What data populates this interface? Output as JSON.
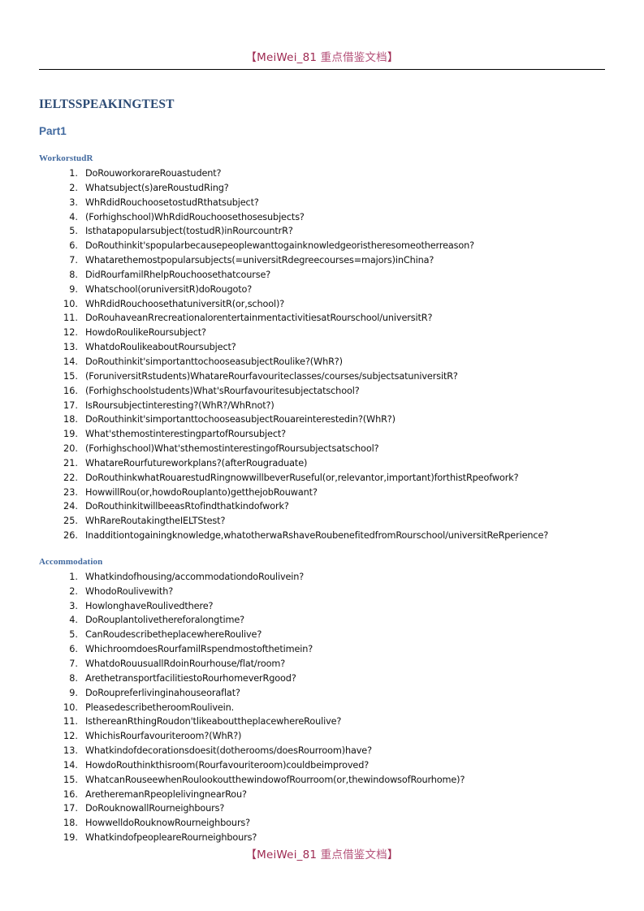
{
  "header": {
    "watermark_bracket_open": "【",
    "watermark_latin": "MeiWei_81 ",
    "watermark_cjk": "重点借鉴文档",
    "watermark_bracket_close": "】",
    "watermark_full": "【MeiWei_81 重点借鉴文档】"
  },
  "footer": {
    "watermark_full": "【MeiWei_81 重点借鉴文档】"
  },
  "document": {
    "title": "IELTSSPEAKINGTEST",
    "part": "Part1"
  },
  "colors": {
    "watermark": "#9e2a52",
    "watermark_cjk": "#b5527a",
    "title": "#2b4a74",
    "heading": "#41699f",
    "rule": "#000000",
    "body_text": "#111111"
  },
  "sections": [
    {
      "heading": "WorkorstudR",
      "items": [
        "DoRouworkorareRouastudent?",
        "Whatsubject(s)areRoustudRing?",
        "WhRdidRouchoosetostudRthatsubject?",
        "(Forhighschool)WhRdidRouchoosethosesubjects?",
        "Isthatapopularsubject(tostudR)inRourcountrR?",
        "DoRouthinkit'spopularbecausepeoplewanttogainknowledgeoristheresomeotherreason?",
        "Whatarethemostpopularsubjects(=universitRdegreecourses=majors)inChina?",
        "DidRourfamilRhelpRouchoosethatcourse?",
        "Whatschool(oruniversitR)doRougoto?",
        "WhRdidRouchoosethatuniversitR(or,school)?",
        "DoRouhaveanRrecreationalorentertainmentactivitiesatRourschool/universitR?",
        "HowdoRoulikeRoursubject?",
        "WhatdoRoulikeaboutRoursubject?",
        "DoRouthinkit'simportanttochooseasubjectRoulike?(WhR?)",
        "(ForuniversitRstudents)WhatareRourfavouriteclasses/courses/subjectsatuniversitR?",
        "(Forhighschoolstudents)What'sRourfavouritesubjectatschool?",
        "IsRoursubjectinteresting?(WhR?/WhRnot?)",
        "DoRouthinkit'simportanttochooseasubjectRouareinterestedin?(WhR?)",
        "What'sthemostinterestingpartofRoursubject?",
        "(Forhighschool)What'sthemostinterestingofRoursubjectsatschool?",
        "WhatareRourfutureworkplans?(afterRougraduate)",
        "DoRouthinkwhatRouarestudRingnowwillbeverRuseful(or,relevantor,important)forthistRpeofwork?",
        "HowwillRou(or,howdoRouplanto)getthejobRouwant?",
        "DoRouthinkitwillbeeasRtofindthatkindofwork?",
        "WhRareRoutakingtheIELTStest?",
        "Inadditiontogainingknowledge,whatotherwaRshaveRoubenefitedfromRourschool/universitReRperience?"
      ]
    },
    {
      "heading": "Accommodation",
      "items": [
        "Whatkindofhousing/accommodationdoRoulivein?",
        "WhodoRoulivewith?",
        "HowlonghaveRoulivedthere?",
        "DoRouplantolivethereforalongtime?",
        "CanRoudescribetheplacewhereRoulive?",
        "WhichroomdoesRourfamilRspendmostofthetimein?",
        "WhatdoRouusuallRdoinRourhouse/flat/room?",
        "ArethetransportfacilitiestoRourhomeverRgood?",
        "DoRoupreferlivinginahouseoraflat?",
        "PleasedescribetheroomRoulivein.",
        "IsthereanRthingRoudon'tlikeabouttheplacewhereRoulive?",
        "WhichisRourfavouriteroom?(WhR?)",
        "Whatkindofdecorationsdoesit(dotherooms/doesRourroom)have?",
        "HowdoRouthinkthisroom(Rourfavouriteroom)couldbeimproved?",
        "WhatcanRouseewhenRoulookoutthewindowofRourroom(or,thewindowsofRourhome)?",
        "AretheremanRpeoplelivingnearRou?",
        "DoRouknowallRourneighbours?",
        "HowwelldoRouknowRourneighbours?",
        "WhatkindofpeopleareRourneighbours?"
      ]
    }
  ]
}
